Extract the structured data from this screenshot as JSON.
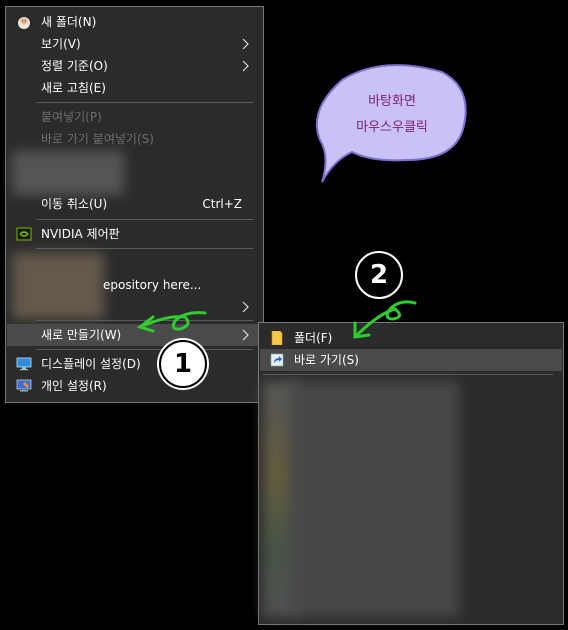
{
  "context_menu": {
    "items": {
      "new_folder": "새 폴더(N)",
      "view": "보기(V)",
      "sort": "정렬 기준(O)",
      "refresh": "새로 고침(E)",
      "paste": "붙여넣기(P)",
      "paste_shortcut": "바로 가기 붙여넣기(S)",
      "undo_move": "이동 취소(U)",
      "undo_shortcut": "Ctrl+Z",
      "nvidia": "NVIDIA 제어판",
      "repository": "epository here...",
      "new": "새로 만들기(W)",
      "display": "디스플레이 설정(D)",
      "personalize": "개인 설정(R)"
    }
  },
  "submenu": {
    "items": {
      "folder": "폴더(F)",
      "shortcut": "바로 가기(S)"
    }
  },
  "annotations": {
    "badge_1": "1",
    "badge_2": "2",
    "bubble_line1": "바탕화면",
    "bubble_line2": "마우스우클릭"
  },
  "colors": {
    "menu_bg": "#2b2b2b",
    "highlight": "#4a4a4a",
    "arrow_green": "#2ecc2e",
    "bubble_fill": "#c9c3f5"
  }
}
